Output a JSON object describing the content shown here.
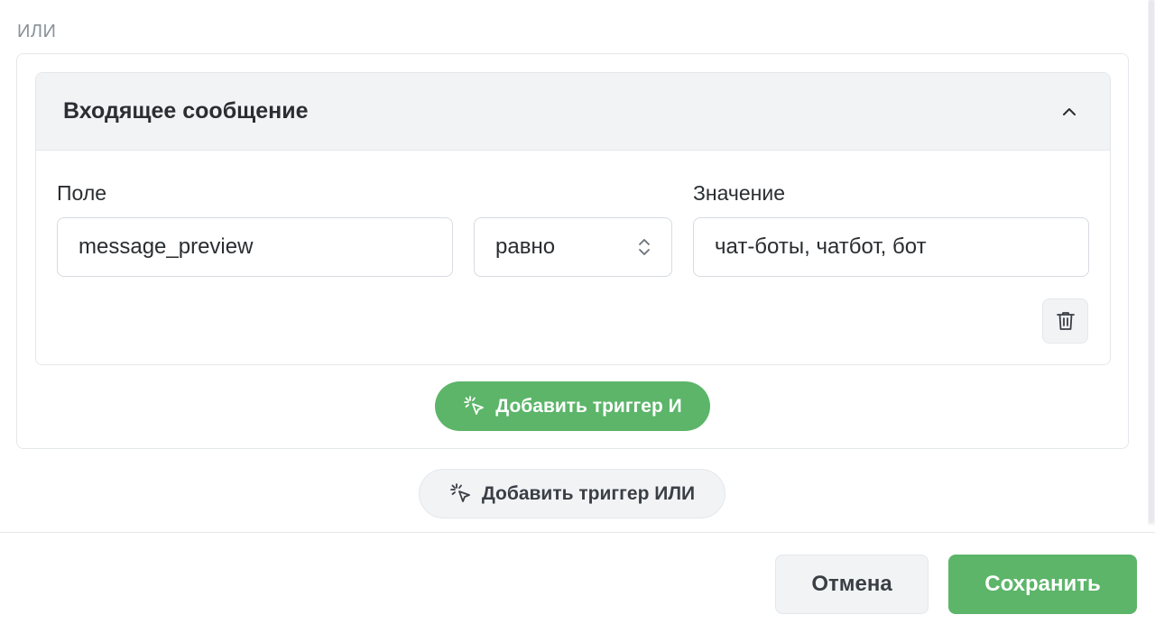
{
  "or_label": "ИЛИ",
  "trigger": {
    "title": "Входящее сообщение",
    "field_label": "Поле",
    "field_value": "message_preview",
    "operator_value": "равно",
    "value_label": "Значение",
    "value_value": "чат-боты, чатбот, бот"
  },
  "buttons": {
    "add_and": "Добавить триггер И",
    "add_or": "Добавить триггер ИЛИ",
    "cancel": "Отмена",
    "save": "Сохранить"
  },
  "icons": {
    "collapse": "chevron-up-icon",
    "operator": "chevron-up-down-icon",
    "delete": "trash-icon",
    "add": "cursor-click-icon"
  },
  "colors": {
    "accent_green": "#5cb569",
    "neutral_bg": "#f2f3f5",
    "border": "#e4e7eb",
    "muted_text": "#8a9199"
  }
}
